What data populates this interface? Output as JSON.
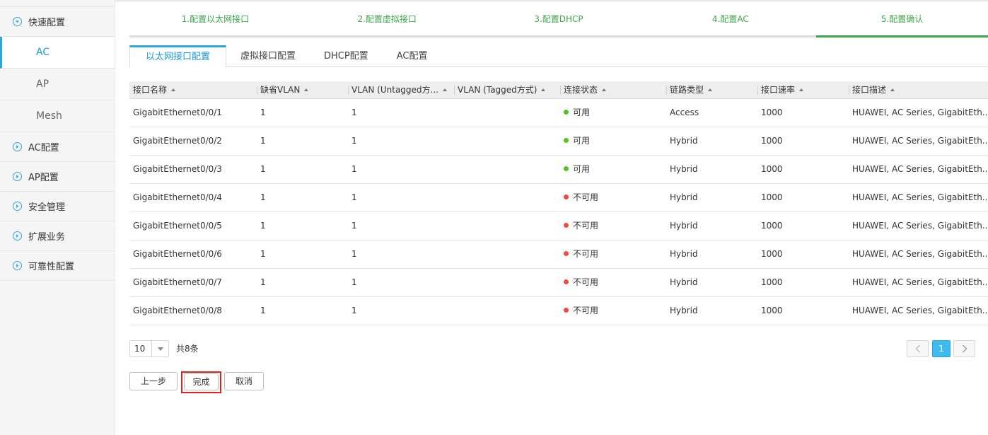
{
  "sidebar": {
    "items": [
      {
        "label": "快速配置",
        "expanded": true,
        "children": [
          {
            "label": "AC",
            "active": true
          },
          {
            "label": "AP",
            "active": false
          },
          {
            "label": "Mesh",
            "active": false
          }
        ]
      },
      {
        "label": "AC配置",
        "expanded": false
      },
      {
        "label": "AP配置",
        "expanded": false
      },
      {
        "label": "安全管理",
        "expanded": false
      },
      {
        "label": "扩展业务",
        "expanded": false
      },
      {
        "label": "可靠性配置",
        "expanded": false
      }
    ]
  },
  "steps": [
    {
      "label": "1.配置以太网接口"
    },
    {
      "label": "2.配置虚拟接口"
    },
    {
      "label": "3.配置DHCP"
    },
    {
      "label": "4.配置AC"
    },
    {
      "label": "5.配置确认",
      "current": true
    }
  ],
  "tabs": [
    {
      "label": "以太网接口配置",
      "active": true
    },
    {
      "label": "虚拟接口配置"
    },
    {
      "label": "DHCP配置"
    },
    {
      "label": "AC配置"
    }
  ],
  "table": {
    "columns": [
      "接口名称",
      "缺省VLAN",
      "VLAN (Untagged方...",
      "VLAN (Tagged方式)",
      "连接状态",
      "链路类型",
      "接口速率",
      "接口描述"
    ],
    "rows": [
      [
        "GigabitEthernet0/0/1",
        "1",
        "1",
        "",
        "可用",
        "Access",
        "1000",
        "HUAWEI, AC Series, GigabitEth..."
      ],
      [
        "GigabitEthernet0/0/2",
        "1",
        "1",
        "",
        "可用",
        "Hybrid",
        "1000",
        "HUAWEI, AC Series, GigabitEth..."
      ],
      [
        "GigabitEthernet0/0/3",
        "1",
        "1",
        "",
        "可用",
        "Hybrid",
        "1000",
        "HUAWEI, AC Series, GigabitEth..."
      ],
      [
        "GigabitEthernet0/0/4",
        "1",
        "1",
        "",
        "不可用",
        "Hybrid",
        "1000",
        "HUAWEI, AC Series, GigabitEth..."
      ],
      [
        "GigabitEthernet0/0/5",
        "1",
        "1",
        "",
        "不可用",
        "Hybrid",
        "1000",
        "HUAWEI, AC Series, GigabitEth..."
      ],
      [
        "GigabitEthernet0/0/6",
        "1",
        "1",
        "",
        "不可用",
        "Hybrid",
        "1000",
        "HUAWEI, AC Series, GigabitEth..."
      ],
      [
        "GigabitEthernet0/0/7",
        "1",
        "1",
        "",
        "不可用",
        "Hybrid",
        "1000",
        "HUAWEI, AC Series, GigabitEth..."
      ],
      [
        "GigabitEthernet0/0/8",
        "1",
        "1",
        "",
        "不可用",
        "Hybrid",
        "1000",
        "HUAWEI, AC Series, GigabitEth..."
      ]
    ],
    "status_colors": {
      "可用": "#52c41a",
      "不可用": "#f5483b"
    }
  },
  "pager": {
    "page_size": "10",
    "total": "共8条",
    "current_page": "1"
  },
  "buttons": {
    "prev": "上一步",
    "finish": "完成",
    "cancel": "取消"
  },
  "colors": {
    "accent": "#29a7e1",
    "step_green": "#3da64b",
    "highlight_red": "#e0201b"
  }
}
